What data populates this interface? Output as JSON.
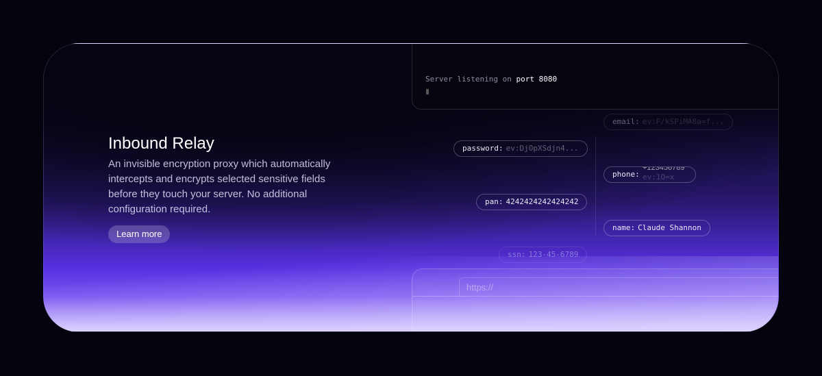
{
  "hero": {
    "title": "Inbound Relay",
    "description": "An invisible encryption proxy which automatically intercepts and encrypts selected sensitive fields before they touch your server. No additional configuration required.",
    "cta": "Learn more"
  },
  "terminal": {
    "prefix": "Server listening on",
    "highlight": "port 8080"
  },
  "chips": {
    "email": {
      "key": "email:",
      "value": "ev:F/kSPiMA8a=f..."
    },
    "password": {
      "key": "password:",
      "value": "ev:DjOpXSdjn4..."
    },
    "phone": {
      "key": "phone:",
      "value": "+123456789",
      "encrypted": "ev:1O=x"
    },
    "pan": {
      "key": "pan:",
      "value": "4242424242424242"
    },
    "name": {
      "key": "name:",
      "value": "Claude Shannon"
    },
    "ssn": {
      "key": "ssn:",
      "value": "123-45-6789"
    }
  },
  "browser": {
    "url_placeholder": "https://"
  }
}
